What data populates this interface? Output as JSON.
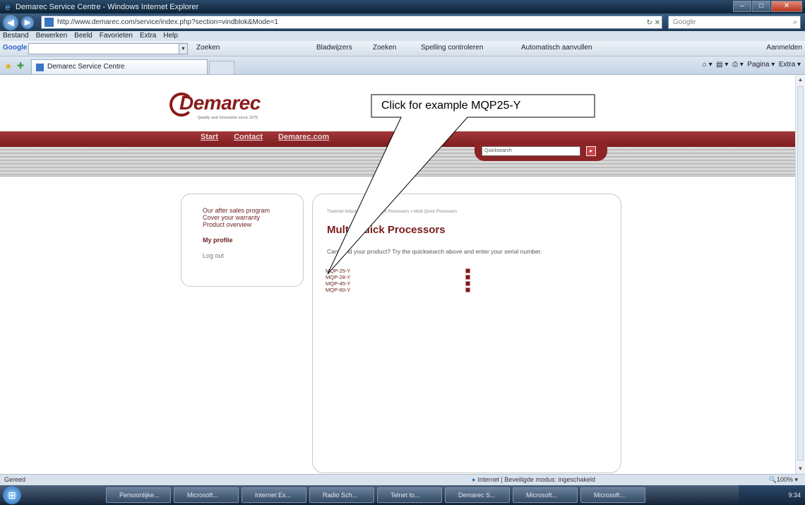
{
  "window": {
    "title": "Demarec Service Centre - Windows Internet Explorer",
    "address": "http://www.demarec.com/service/index.php?section=vindblok&Mode=1",
    "search_placeholder": "Google"
  },
  "menu": [
    "Bestand",
    "Bewerken",
    "Beeld",
    "Favorieten",
    "Extra",
    "Help"
  ],
  "google_bar": {
    "zoeken": "Zoeken",
    "bladwijzers": "Bladwijzers",
    "zoeken2": "Zoeken",
    "spelling": "Spelling controleren",
    "autofill": "Automatisch aanvullen",
    "aanmelden": "Aanmelden"
  },
  "tab": {
    "label": "Demarec Service Centre"
  },
  "commandbar": {
    "pagina": "Pagina",
    "extra": "Extra"
  },
  "site": {
    "logo": "Demarec",
    "logo_tagline": "Quality and Innovation since 1975",
    "nav": [
      "Start",
      "Contact",
      "Demarec.com"
    ],
    "quicksearch_placeholder": "Quicksearch",
    "sidebar": {
      "links": [
        "Our after sales program",
        "Cover your warranty",
        "Product overview"
      ],
      "profile": "My profile",
      "logout": "Log out"
    },
    "breadcrumb": "Thamnet Industrie » Multi Quick Processors » Multi Quick Processors",
    "title": "Multi-Quick Processors",
    "intro": "Can't find your product? Try the quicksearch above and enter your serial number.",
    "products": [
      "MQP-25-Y",
      "MQP-28-Y",
      "MQP-45-Y",
      "MQP-60-Y"
    ]
  },
  "callout": {
    "text": "Click for example MQP25-Y"
  },
  "status": {
    "left": "Gereed",
    "zone": "Internet | Beveiligde modus: ingeschakeld",
    "zoom": "100%"
  },
  "taskbar": {
    "items": [
      "Persoonlijke...",
      "Microsoft...",
      "Internet Ex...",
      "Radio Sch...",
      "Telnet to...",
      "Demarec S...",
      "Microsoft...",
      "Microsoft..."
    ],
    "clock": "9:34"
  }
}
